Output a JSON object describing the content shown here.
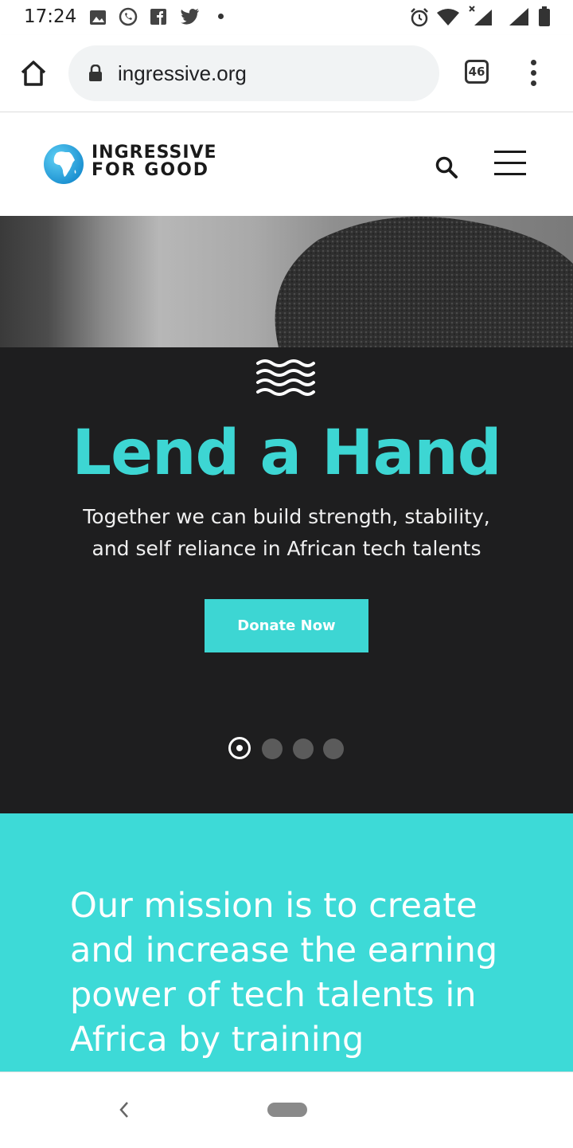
{
  "status_bar": {
    "time": "17:24",
    "left_icons": [
      "image-icon",
      "whatsapp-icon",
      "facebook-icon",
      "twitter-icon",
      "dot-icon"
    ],
    "right_icons": [
      "alarm-icon",
      "wifi-icon",
      "signal-icon",
      "signal-icon",
      "battery-icon"
    ]
  },
  "browser": {
    "url": "ingressive.org",
    "tab_count": "46",
    "icons": {
      "home": "home-icon",
      "lock": "lock-icon",
      "menu": "more-vert-icon"
    }
  },
  "site_header": {
    "logo_line1": "INGRESSIVE",
    "logo_line2": "FOR GOOD",
    "icons": {
      "logo": "africa-globe-icon",
      "search": "search-icon",
      "menu": "hamburger-icon"
    }
  },
  "hero": {
    "title": "Lend a Hand",
    "subtitle": "Together we can build strength, stability, and self reliance in African tech talents",
    "cta_label": "Donate Now",
    "slide_count": 4,
    "active_slide": 1,
    "colors": {
      "accent": "#3dd6d3",
      "background": "#1e1e1f"
    }
  },
  "mission": {
    "text": "Our mission is to create and increase the earning power of tech talents in Africa by training",
    "background": "#3ddad7"
  },
  "nav_bar": {
    "icons": {
      "back": "back-chevron-icon",
      "home": "home-pill-icon"
    }
  }
}
